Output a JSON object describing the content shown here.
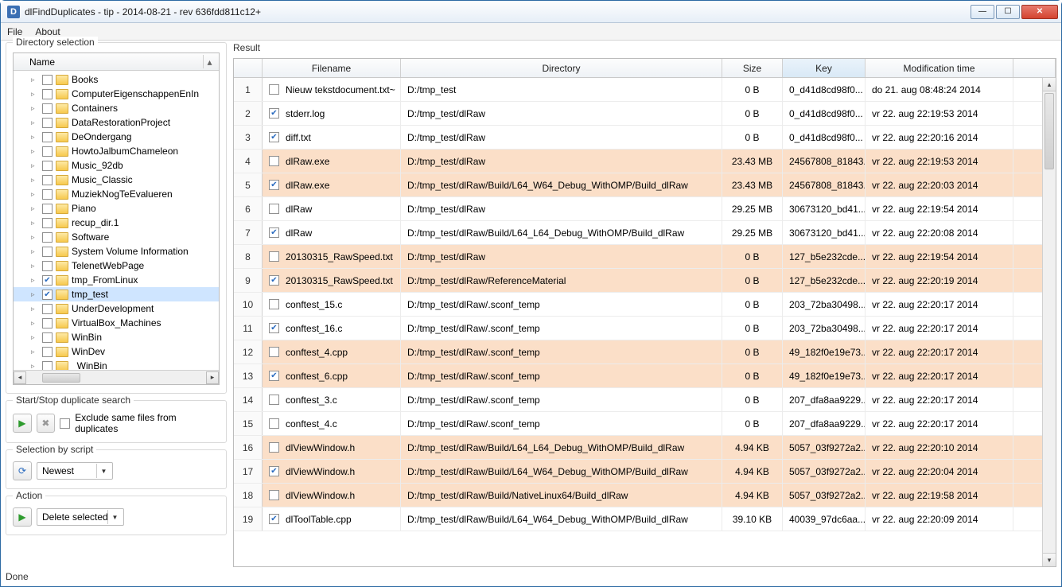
{
  "window": {
    "title": "dlFindDuplicates - tip - 2014-08-21 - rev 636fdd811c12+",
    "app_icon_letter": "D"
  },
  "menu": {
    "file": "File",
    "about": "About"
  },
  "left": {
    "dir_selection_legend": "Directory selection",
    "tree_header": "Name",
    "tree": [
      {
        "label": "Books",
        "checked": false
      },
      {
        "label": "ComputerEigenschappenEnIn",
        "checked": false
      },
      {
        "label": "Containers",
        "checked": false
      },
      {
        "label": "DataRestorationProject",
        "checked": false
      },
      {
        "label": "DeOndergang",
        "checked": false
      },
      {
        "label": "HowtoJalbumChameleon",
        "checked": false
      },
      {
        "label": "Music_92db",
        "checked": false
      },
      {
        "label": "Music_Classic",
        "checked": false
      },
      {
        "label": "MuziekNogTeEvalueren",
        "checked": false
      },
      {
        "label": "Piano",
        "checked": false
      },
      {
        "label": "recup_dir.1",
        "checked": false
      },
      {
        "label": "Software",
        "checked": false
      },
      {
        "label": "System Volume Information",
        "checked": false
      },
      {
        "label": "TelenetWebPage",
        "checked": false
      },
      {
        "label": "tmp_FromLinux",
        "checked": true
      },
      {
        "label": "tmp_test",
        "checked": true,
        "selected": true
      },
      {
        "label": "UnderDevelopment",
        "checked": false
      },
      {
        "label": "VirtualBox_Machines",
        "checked": false
      },
      {
        "label": "WinBin",
        "checked": false
      },
      {
        "label": "WinDev",
        "checked": false
      },
      {
        "label": "_WinBin_",
        "checked": false
      }
    ],
    "search_legend": "Start/Stop duplicate search",
    "exclude_label": "Exclude same files from duplicates",
    "script_legend": "Selection by script",
    "script_combo": "Newest",
    "action_legend": "Action",
    "action_combo": "Delete selected"
  },
  "result": {
    "label": "Result",
    "columns": {
      "filename": "Filename",
      "directory": "Directory",
      "size": "Size",
      "key": "Key",
      "mod": "Modification time"
    },
    "rows": [
      {
        "n": "1",
        "ck": false,
        "hl": false,
        "f": "Nieuw tekstdocument.txt~",
        "d": "D:/tmp_test",
        "s": "0 B",
        "k": "0_d41d8cd98f0...",
        "m": "do 21. aug 08:48:24 2014"
      },
      {
        "n": "2",
        "ck": true,
        "hl": false,
        "f": "stderr.log",
        "d": "D:/tmp_test/dlRaw",
        "s": "0 B",
        "k": "0_d41d8cd98f0...",
        "m": "vr 22. aug 22:19:53 2014"
      },
      {
        "n": "3",
        "ck": true,
        "hl": false,
        "f": "diff.txt",
        "d": "D:/tmp_test/dlRaw",
        "s": "0 B",
        "k": "0_d41d8cd98f0...",
        "m": "vr 22. aug 22:20:16 2014"
      },
      {
        "n": "4",
        "ck": false,
        "hl": true,
        "f": "dlRaw.exe",
        "d": "D:/tmp_test/dlRaw",
        "s": "23.43 MB",
        "k": "24567808_81843...",
        "m": "vr 22. aug 22:19:53 2014"
      },
      {
        "n": "5",
        "ck": true,
        "hl": true,
        "f": "dlRaw.exe",
        "d": "D:/tmp_test/dlRaw/Build/L64_W64_Debug_WithOMP/Build_dlRaw",
        "s": "23.43 MB",
        "k": "24567808_81843...",
        "m": "vr 22. aug 22:20:03 2014"
      },
      {
        "n": "6",
        "ck": false,
        "hl": false,
        "f": "dlRaw",
        "d": "D:/tmp_test/dlRaw",
        "s": "29.25 MB",
        "k": "30673120_bd41...",
        "m": "vr 22. aug 22:19:54 2014"
      },
      {
        "n": "7",
        "ck": true,
        "hl": false,
        "f": "dlRaw",
        "d": "D:/tmp_test/dlRaw/Build/L64_L64_Debug_WithOMP/Build_dlRaw",
        "s": "29.25 MB",
        "k": "30673120_bd41...",
        "m": "vr 22. aug 22:20:08 2014"
      },
      {
        "n": "8",
        "ck": false,
        "hl": true,
        "f": "20130315_RawSpeed.txt",
        "d": "D:/tmp_test/dlRaw",
        "s": "0 B",
        "k": "127_b5e232cde...",
        "m": "vr 22. aug 22:19:54 2014"
      },
      {
        "n": "9",
        "ck": true,
        "hl": true,
        "f": "20130315_RawSpeed.txt",
        "d": "D:/tmp_test/dlRaw/ReferenceMaterial",
        "s": "0 B",
        "k": "127_b5e232cde...",
        "m": "vr 22. aug 22:20:19 2014"
      },
      {
        "n": "10",
        "ck": false,
        "hl": false,
        "f": "conftest_15.c",
        "d": "D:/tmp_test/dlRaw/.sconf_temp",
        "s": "0 B",
        "k": "203_72ba30498...",
        "m": "vr 22. aug 22:20:17 2014"
      },
      {
        "n": "11",
        "ck": true,
        "hl": false,
        "f": "conftest_16.c",
        "d": "D:/tmp_test/dlRaw/.sconf_temp",
        "s": "0 B",
        "k": "203_72ba30498...",
        "m": "vr 22. aug 22:20:17 2014"
      },
      {
        "n": "12",
        "ck": false,
        "hl": true,
        "f": "conftest_4.cpp",
        "d": "D:/tmp_test/dlRaw/.sconf_temp",
        "s": "0 B",
        "k": "49_182f0e19e73...",
        "m": "vr 22. aug 22:20:17 2014"
      },
      {
        "n": "13",
        "ck": true,
        "hl": true,
        "f": "conftest_6.cpp",
        "d": "D:/tmp_test/dlRaw/.sconf_temp",
        "s": "0 B",
        "k": "49_182f0e19e73...",
        "m": "vr 22. aug 22:20:17 2014"
      },
      {
        "n": "14",
        "ck": false,
        "hl": false,
        "f": "conftest_3.c",
        "d": "D:/tmp_test/dlRaw/.sconf_temp",
        "s": "0 B",
        "k": "207_dfa8aa9229...",
        "m": "vr 22. aug 22:20:17 2014"
      },
      {
        "n": "15",
        "ck": false,
        "hl": false,
        "f": "conftest_4.c",
        "d": "D:/tmp_test/dlRaw/.sconf_temp",
        "s": "0 B",
        "k": "207_dfa8aa9229...",
        "m": "vr 22. aug 22:20:17 2014"
      },
      {
        "n": "16",
        "ck": false,
        "hl": true,
        "f": "dlViewWindow.h",
        "d": "D:/tmp_test/dlRaw/Build/L64_L64_Debug_WithOMP/Build_dlRaw",
        "s": "4.94 KB",
        "k": "5057_03f9272a2...",
        "m": "vr 22. aug 22:20:10 2014"
      },
      {
        "n": "17",
        "ck": true,
        "hl": true,
        "f": "dlViewWindow.h",
        "d": "D:/tmp_test/dlRaw/Build/L64_W64_Debug_WithOMP/Build_dlRaw",
        "s": "4.94 KB",
        "k": "5057_03f9272a2...",
        "m": "vr 22. aug 22:20:04 2014"
      },
      {
        "n": "18",
        "ck": false,
        "hl": true,
        "f": "dlViewWindow.h",
        "d": "D:/tmp_test/dlRaw/Build/NativeLinux64/Build_dlRaw",
        "s": "4.94 KB",
        "k": "5057_03f9272a2...",
        "m": "vr 22. aug 22:19:58 2014"
      },
      {
        "n": "19",
        "ck": true,
        "hl": false,
        "f": "dlToolTable.cpp",
        "d": "D:/tmp_test/dlRaw/Build/L64_W64_Debug_WithOMP/Build_dlRaw",
        "s": "39.10 KB",
        "k": "40039_97dc6aa...",
        "m": "vr 22. aug 22:20:09 2014"
      }
    ]
  },
  "status": "Done"
}
